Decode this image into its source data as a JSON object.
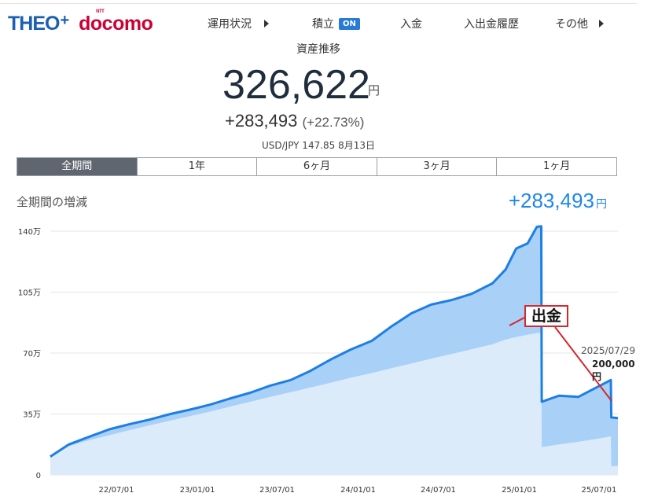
{
  "header": {
    "logo_theo": "THEO",
    "logo_plus": "+",
    "logo_docomo": "docomo",
    "logo_ntt": "NTT",
    "nav": [
      {
        "label": "運用状況",
        "arrow": true
      },
      {
        "label": "積立",
        "badge": "ON"
      },
      {
        "label": "入金"
      },
      {
        "label": "入出金履歴"
      },
      {
        "label": "その他",
        "arrow": true
      }
    ]
  },
  "summary": {
    "title": "資産推移",
    "value": "326,622",
    "unit": "円",
    "gain": "+283,493",
    "gain_pct": "(+22.73%)",
    "fx": "USD/JPY 147.85 8月13日"
  },
  "periods": [
    {
      "label": "全期間",
      "active": true
    },
    {
      "label": "1年",
      "active": false
    },
    {
      "label": "6ヶ月",
      "active": false
    },
    {
      "label": "3ヶ月",
      "active": false
    },
    {
      "label": "1ヶ月",
      "active": false
    }
  ],
  "growth": {
    "label": "全期間の増減",
    "value": "+283,493",
    "unit": "円"
  },
  "annotation": {
    "label": "出金",
    "date": "2025/07/29",
    "amount": "200,000 円"
  },
  "colors": {
    "line": "#1e7ee4",
    "gain_fill": "#a9d0f7",
    "deposit_fill": "#dcebfa",
    "annotation_border": "#d7262c",
    "active_tab": "#5f6670"
  },
  "chart_data": {
    "type": "area",
    "ytick_labels": [
      "0",
      "35万",
      "70万",
      "105万",
      "140万"
    ],
    "yticks": [
      0,
      350000,
      700000,
      1050000,
      1400000
    ],
    "xtick_labels": [
      "22/07/01",
      "23/01/01",
      "23/07/01",
      "24/01/01",
      "24/07/01",
      "25/01/01",
      "25/07/01"
    ],
    "xticks": [
      "2022-07-01",
      "2023-01-01",
      "2023-07-01",
      "2024-01-01",
      "2024-07-01",
      "2025-01-01",
      "2025-07-01"
    ],
    "x_range": [
      "2022-02-01",
      "2025-08-13"
    ],
    "ylim": [
      0,
      1400000
    ],
    "grid": true,
    "series": [
      {
        "kind": "valuation",
        "points": [
          [
            "2022-02-01",
            105000
          ],
          [
            "2022-03-15",
            175000
          ],
          [
            "2022-05-01",
            220000
          ],
          [
            "2022-06-15",
            262000
          ],
          [
            "2022-08-01",
            292000
          ],
          [
            "2022-09-15",
            318000
          ],
          [
            "2022-11-01",
            350000
          ],
          [
            "2022-12-15",
            375000
          ],
          [
            "2023-02-01",
            405000
          ],
          [
            "2023-03-15",
            438000
          ],
          [
            "2023-05-01",
            472000
          ],
          [
            "2023-06-15",
            512000
          ],
          [
            "2023-08-01",
            545000
          ],
          [
            "2023-09-15",
            598000
          ],
          [
            "2023-11-01",
            665000
          ],
          [
            "2023-12-15",
            720000
          ],
          [
            "2024-02-01",
            770000
          ],
          [
            "2024-03-15",
            850000
          ],
          [
            "2024-05-01",
            928000
          ],
          [
            "2024-06-15",
            978000
          ],
          [
            "2024-08-01",
            1005000
          ],
          [
            "2024-09-15",
            1040000
          ],
          [
            "2024-11-01",
            1100000
          ],
          [
            "2024-12-01",
            1180000
          ],
          [
            "2024-12-25",
            1300000
          ],
          [
            "2025-01-20",
            1330000
          ],
          [
            "2025-02-10",
            1425000
          ],
          [
            "2025-02-20",
            1428000
          ],
          [
            "2025-02-21",
            420000
          ],
          [
            "2025-04-01",
            455000
          ],
          [
            "2025-05-15",
            448000
          ],
          [
            "2025-07-15",
            528000
          ],
          [
            "2025-07-28",
            545000
          ],
          [
            "2025-07-29",
            330000
          ],
          [
            "2025-08-13",
            326622
          ]
        ]
      },
      {
        "kind": "deposits",
        "points": [
          [
            "2022-02-01",
            100000
          ],
          [
            "2022-03-15",
            165000
          ],
          [
            "2022-05-01",
            200000
          ],
          [
            "2022-06-15",
            228000
          ],
          [
            "2022-08-01",
            258000
          ],
          [
            "2022-09-15",
            285000
          ],
          [
            "2022-11-01",
            312000
          ],
          [
            "2022-12-15",
            338000
          ],
          [
            "2023-02-01",
            365000
          ],
          [
            "2023-03-15",
            392000
          ],
          [
            "2023-05-01",
            420000
          ],
          [
            "2023-06-15",
            448000
          ],
          [
            "2023-08-01",
            475000
          ],
          [
            "2023-09-15",
            502000
          ],
          [
            "2023-11-01",
            530000
          ],
          [
            "2023-12-15",
            558000
          ],
          [
            "2024-02-01",
            585000
          ],
          [
            "2024-03-15",
            612000
          ],
          [
            "2024-05-01",
            640000
          ],
          [
            "2024-06-15",
            668000
          ],
          [
            "2024-08-01",
            695000
          ],
          [
            "2024-09-15",
            722000
          ],
          [
            "2024-11-01",
            750000
          ],
          [
            "2024-12-01",
            778000
          ],
          [
            "2024-12-25",
            792000
          ],
          [
            "2025-01-20",
            805000
          ],
          [
            "2025-02-10",
            815000
          ],
          [
            "2025-02-20",
            818000
          ],
          [
            "2025-02-21",
            160000
          ],
          [
            "2025-04-01",
            175000
          ],
          [
            "2025-05-15",
            190000
          ],
          [
            "2025-07-15",
            215000
          ],
          [
            "2025-07-28",
            222000
          ],
          [
            "2025-07-29",
            50000
          ],
          [
            "2025-08-13",
            52000
          ]
        ]
      }
    ]
  }
}
